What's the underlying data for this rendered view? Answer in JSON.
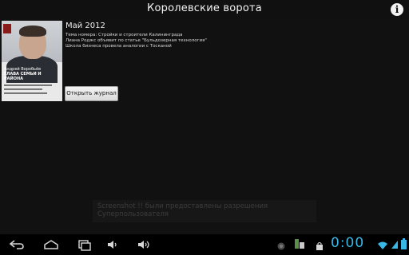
{
  "app": {
    "title": "Королевские ворота"
  },
  "header": {
    "info_icon_glyph": "i"
  },
  "issue": {
    "date": "Май 2012",
    "headlines": [
      "Тема номера: Стройки и строители Калининграда",
      "Лиана Роджс объявит по статье \"Бульдозерная технология\"",
      "Школа бизнеса провела аналогии с Тосканой"
    ],
    "open_button_label": "Открыть журнал",
    "cover": {
      "headline": "ГЛАВА СЕМЬИ И РАЙОНА",
      "kicker": "Андрей Воробьёв"
    }
  },
  "toast": {
    "line1": "Screenshot !! были предоставлены разрешения",
    "line2": "Суперпользователя"
  },
  "statusbar": {
    "clock": "0:00",
    "accent_color": "#39b7e6"
  },
  "navbar": {
    "icons": [
      "back-icon",
      "home-icon",
      "recent-apps-icon",
      "volume-down-icon",
      "volume-up-icon"
    ]
  }
}
